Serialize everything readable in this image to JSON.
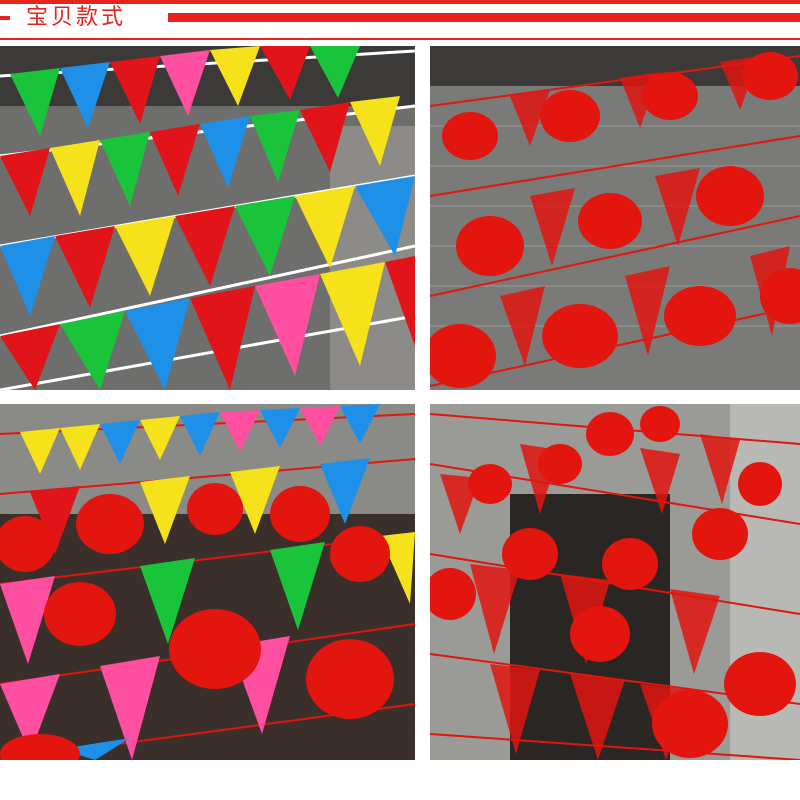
{
  "header": {
    "title": "宝贝款式",
    "accent_color": "#e8231c"
  },
  "photos": [
    {
      "subject": "multicolor-pennant-bunting"
    },
    {
      "subject": "red-lanterns-and-double-happiness-pennants"
    },
    {
      "subject": "multicolor-pennants-with-red-lanterns"
    },
    {
      "subject": "red-fortune-pennants-and-red-lanterns"
    }
  ],
  "palette": {
    "bunting": [
      "#e01419",
      "#1e90e8",
      "#19c43a",
      "#f6e21a",
      "#ff4fa0",
      "#ff6a00"
    ],
    "lantern": "#e2150f",
    "wall": "#7a7a78"
  }
}
